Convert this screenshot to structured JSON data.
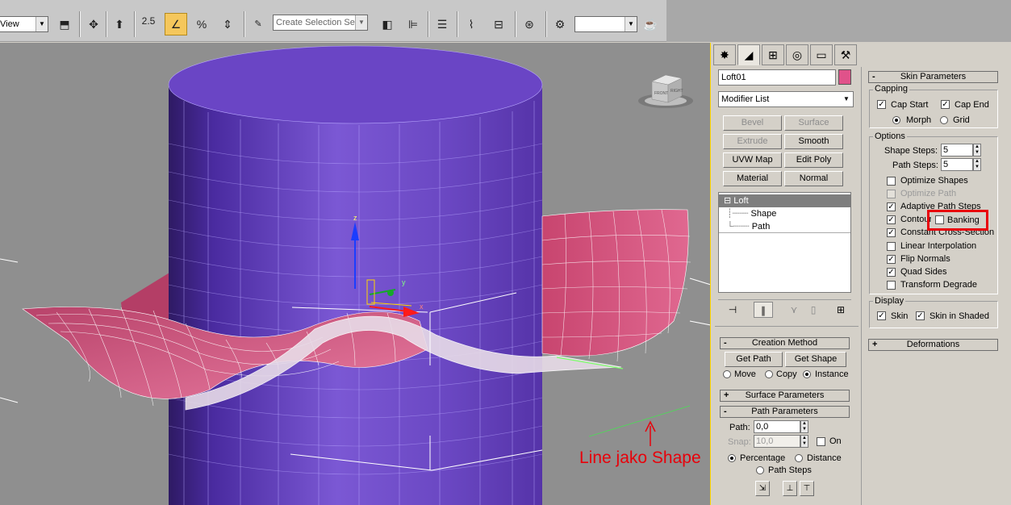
{
  "toolbar": {
    "view_dropdown": "View",
    "snap_value": "2.5",
    "selection_set_placeholder": "Create Selection Se",
    "empty_dropdown": "",
    "icons": [
      "select-link-icon",
      "move-icon",
      "align-icon",
      "snap-icon",
      "angle-snap-icon",
      "percent-snap-icon",
      "spinner-snap-icon",
      "edit-named-selection-icon",
      "mirror-icon",
      "align-tool-icon",
      "layer-icon",
      "curve-editor-icon",
      "schematic-icon",
      "material-editor-icon",
      "render-setup-icon",
      "render-frame-icon",
      "teapot-icon"
    ]
  },
  "viewport": {
    "annotation_text": "Line jako Shape",
    "viewcube_front": "FRONT",
    "viewcube_right": "RIGHT",
    "gizmo_labels": {
      "z": "z",
      "x": "x",
      "y": "y"
    },
    "colors": {
      "background": "#8f8f8f",
      "cylinder": "#6a3fc0",
      "surface": "#d9557f",
      "annotation": "#e8000a"
    }
  },
  "command_panel": {
    "tabs": [
      "create-tab",
      "modify-tab",
      "hierarchy-tab",
      "motion-tab",
      "display-tab",
      "utilities-tab"
    ],
    "object_name": "Loft01",
    "object_color": "#e0528a",
    "modifier_list": "Modifier List",
    "modifier_buttons": [
      {
        "label": "Bevel",
        "enabled": false
      },
      {
        "label": "Surface",
        "enabled": false
      },
      {
        "label": "Extrude",
        "enabled": false
      },
      {
        "label": "Smooth",
        "enabled": true
      },
      {
        "label": "UVW Map",
        "enabled": true
      },
      {
        "label": "Edit Poly",
        "enabled": true
      },
      {
        "label": "Material",
        "enabled": true
      },
      {
        "label": "Normal",
        "enabled": true
      }
    ],
    "stack": {
      "root": "Loft",
      "root_toggle": "⊟",
      "children": [
        "Shape",
        "Path"
      ]
    },
    "creation_method": {
      "title": "Creation Method",
      "toggle": "-",
      "get_path": "Get Path",
      "get_shape": "Get Shape",
      "options": [
        "Move",
        "Copy",
        "Instance"
      ],
      "selected": "Instance"
    },
    "surface_parameters": {
      "title": "Surface Parameters",
      "toggle": "+"
    },
    "path_parameters": {
      "title": "Path Parameters",
      "toggle": "-",
      "path_label": "Path:",
      "path_value": "0,0",
      "snap_label": "Snap:",
      "snap_value": "10,0",
      "on_label": "On",
      "percentage": "Percentage",
      "distance": "Distance",
      "path_steps": "Path Steps",
      "selected": "Percentage"
    }
  },
  "skin_parameters": {
    "title": "Skin Parameters",
    "toggle": "-",
    "capping": {
      "label": "Capping",
      "cap_start": "Cap Start",
      "cap_start_checked": true,
      "cap_end": "Cap End",
      "cap_end_checked": true,
      "morph": "Morph",
      "grid": "Grid",
      "selected": "Morph"
    },
    "options": {
      "label": "Options",
      "shape_steps_label": "Shape Steps:",
      "shape_steps": "5",
      "path_steps_label": "Path Steps:",
      "path_steps": "5",
      "checks": [
        {
          "label": "Optimize Shapes",
          "checked": false,
          "enabled": true
        },
        {
          "label": "Optimize Path",
          "checked": false,
          "enabled": false
        },
        {
          "label": "Adaptive Path Steps",
          "checked": true,
          "enabled": true
        },
        {
          "label": "Contour",
          "checked": true,
          "enabled": true
        },
        {
          "label": "Constant Cross-Section",
          "checked": true,
          "enabled": true
        },
        {
          "label": "Linear Interpolation",
          "checked": false,
          "enabled": true
        },
        {
          "label": "Flip Normals",
          "checked": true,
          "enabled": true
        },
        {
          "label": "Quad Sides",
          "checked": true,
          "enabled": true
        },
        {
          "label": "Transform Degrade",
          "checked": false,
          "enabled": true
        }
      ],
      "banking": "Banking",
      "banking_checked": false
    },
    "display": {
      "label": "Display",
      "skin": "Skin",
      "skin_checked": true,
      "skin_shaded": "Skin in Shaded",
      "skin_shaded_checked": true
    }
  },
  "deformations": {
    "title": "Deformations",
    "toggle": "+"
  }
}
